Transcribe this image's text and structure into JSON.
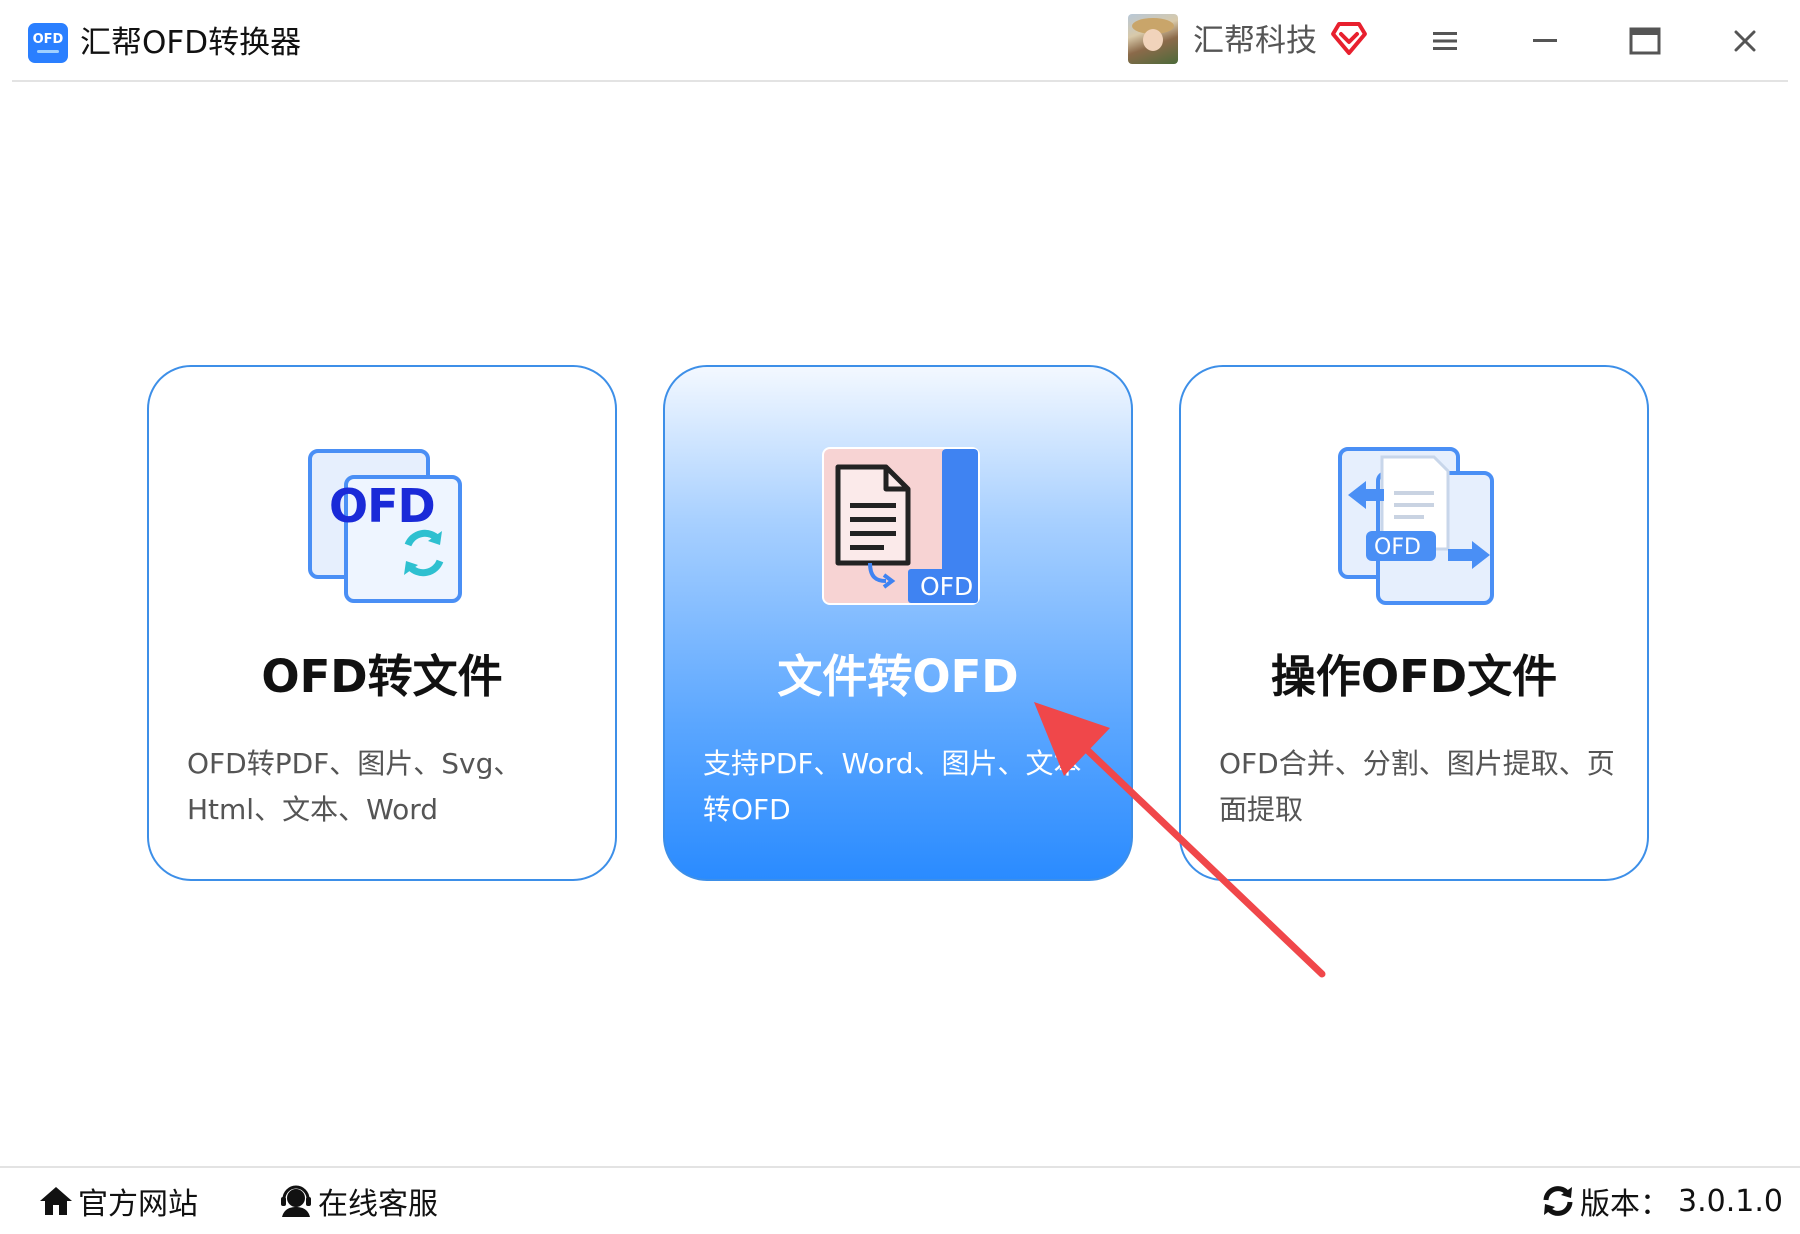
{
  "app": {
    "logo_text": "OFD",
    "title": "汇帮OFD转换器"
  },
  "user": {
    "name": "汇帮科技",
    "vip_icon": "vip-diamond-icon"
  },
  "window_controls": {
    "menu_icon": "hamburger-menu-icon",
    "minimize_icon": "minimize-icon",
    "maximize_icon": "maximize-icon",
    "close_icon": "close-icon"
  },
  "cards": [
    {
      "title": "OFD转文件",
      "description": "OFD转PDF、图片、Svg、Html、文本、Word",
      "icon_text": "OFD",
      "icon": "ofd-convert-icon"
    },
    {
      "title": "文件转OFD",
      "description": "支持PDF、Word、图片、文本转OFD",
      "icon_text": "OFD",
      "icon": "file-to-ofd-icon"
    },
    {
      "title": "操作OFD文件",
      "description": "OFD合并、分割、图片提取、页面提取",
      "icon_text": "OFD",
      "icon": "ofd-operate-icon"
    }
  ],
  "footer": {
    "official_site": "官方网站",
    "online_support": "在线客服",
    "version_label": "版本：",
    "version_value": "3.0.1.0"
  },
  "colors": {
    "accent": "#2a8bff",
    "card_border": "#3d8fe8",
    "annotation_arrow": "#f0474a",
    "icon_blue": "#4a8ff5",
    "icon_dark_blue": "#1a2ad8",
    "icon_teal": "#2ec0d0"
  }
}
